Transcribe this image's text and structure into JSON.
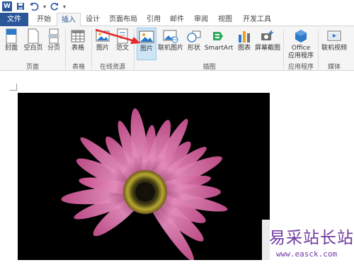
{
  "app": {
    "logo_letter": "W",
    "qat_dropdown": "▾"
  },
  "tabs": [
    {
      "label": "文件"
    },
    {
      "label": "开始"
    },
    {
      "label": "插入"
    },
    {
      "label": "设计"
    },
    {
      "label": "页面布局"
    },
    {
      "label": "引用"
    },
    {
      "label": "邮件"
    },
    {
      "label": "审阅"
    },
    {
      "label": "视图"
    },
    {
      "label": "开发工具"
    }
  ],
  "ribbon": {
    "buttons": {
      "cover": "封面",
      "blank_page": "空白页",
      "page_break": "分页",
      "table": "表格",
      "picture": "图片",
      "template": "范文",
      "picture_selected": "图片",
      "online_picture": "联机图片",
      "shapes": "形状",
      "smartart": "SmartArt",
      "chart": "图表",
      "screenshot": "屏幕截图",
      "office_apps_line1": "Office",
      "office_apps_line2": "应用程序",
      "online_video": "联机视频"
    },
    "groups": {
      "pages": "页面",
      "tables": "表格",
      "online_resources": "在线资源",
      "illustrations": "插图",
      "apps": "应用程序",
      "media": "媒体"
    }
  },
  "watermark": {
    "title": "易采站长站",
    "url": "www.easck.com"
  },
  "colors": {
    "brand": "#2b579a",
    "arrow": "#e8262a",
    "selected": "#cde6f7",
    "watermark": "#6f3a9f"
  }
}
